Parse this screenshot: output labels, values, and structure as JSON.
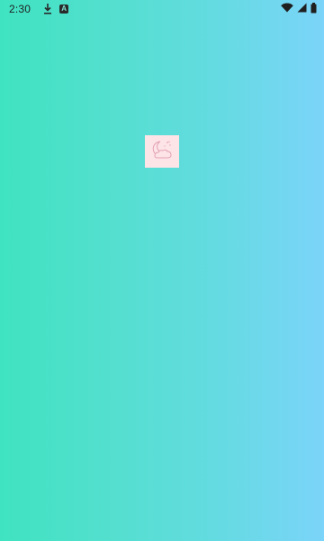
{
  "status_bar": {
    "time": "2:30",
    "notification_icons": [
      "download-icon",
      "a-badge-icon"
    ],
    "system_icons": [
      "wifi-icon",
      "signal-icon",
      "battery-icon"
    ],
    "a_badge_text": "A"
  },
  "splash": {
    "logo_icon": "moon-cloud-stars-icon",
    "logo_bg_color": "#fde4e6",
    "logo_line_color": "#e7a6b8"
  },
  "theme": {
    "gradient_start": "#3fe3c1",
    "gradient_end": "#7bd4f9"
  }
}
